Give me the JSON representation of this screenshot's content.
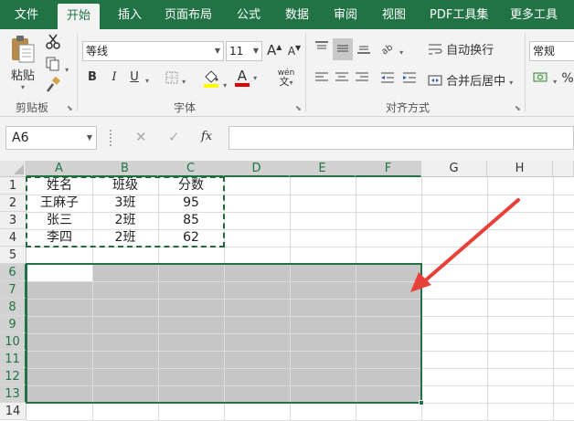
{
  "tabs": [
    {
      "label": "文件",
      "active": false
    },
    {
      "label": "开始",
      "active": true
    },
    {
      "label": "插入",
      "active": false
    },
    {
      "label": "页面布局",
      "active": false
    },
    {
      "label": "公式",
      "active": false
    },
    {
      "label": "数据",
      "active": false
    },
    {
      "label": "审阅",
      "active": false
    },
    {
      "label": "视图",
      "active": false
    },
    {
      "label": "PDF工具集",
      "active": false
    },
    {
      "label": "更多工具",
      "active": false
    }
  ],
  "ribbon": {
    "clipboard": {
      "label": "剪贴板",
      "paste_label": "粘贴"
    },
    "font": {
      "label": "字体",
      "font_name": "等线",
      "font_size": "11",
      "bold": "B",
      "italic": "I",
      "underline": "U",
      "grow": "A",
      "shrink": "A",
      "font_color": "A",
      "phonetic": "wén"
    },
    "alignment": {
      "label": "对齐方式",
      "wrap_label": "自动换行",
      "merge_label": "合并后居中"
    },
    "number": {
      "format": "常规",
      "percent": "%"
    }
  },
  "formula_bar": {
    "name_box": "A6",
    "cancel": "✕",
    "confirm": "✓",
    "fx": "fx",
    "value": ""
  },
  "grid": {
    "columns": [
      "A",
      "B",
      "C",
      "D",
      "E",
      "F",
      "G",
      "H"
    ],
    "rows": [
      "1",
      "2",
      "3",
      "4",
      "5",
      "6",
      "7",
      "8",
      "9",
      "10",
      "11",
      "12",
      "13",
      "14"
    ],
    "cells": [
      [
        "姓名",
        "班级",
        "分数"
      ],
      [
        "王麻子",
        "3班",
        "95"
      ],
      [
        "张三",
        "2班",
        "85"
      ],
      [
        "李四",
        "2班",
        "62"
      ]
    ],
    "selection": "A6:F13",
    "copy_range": "A1:C4"
  },
  "colors": {
    "accent": "#217346",
    "selection_fill": "#c6c6c6",
    "annotation_arrow": "#e8413a"
  }
}
